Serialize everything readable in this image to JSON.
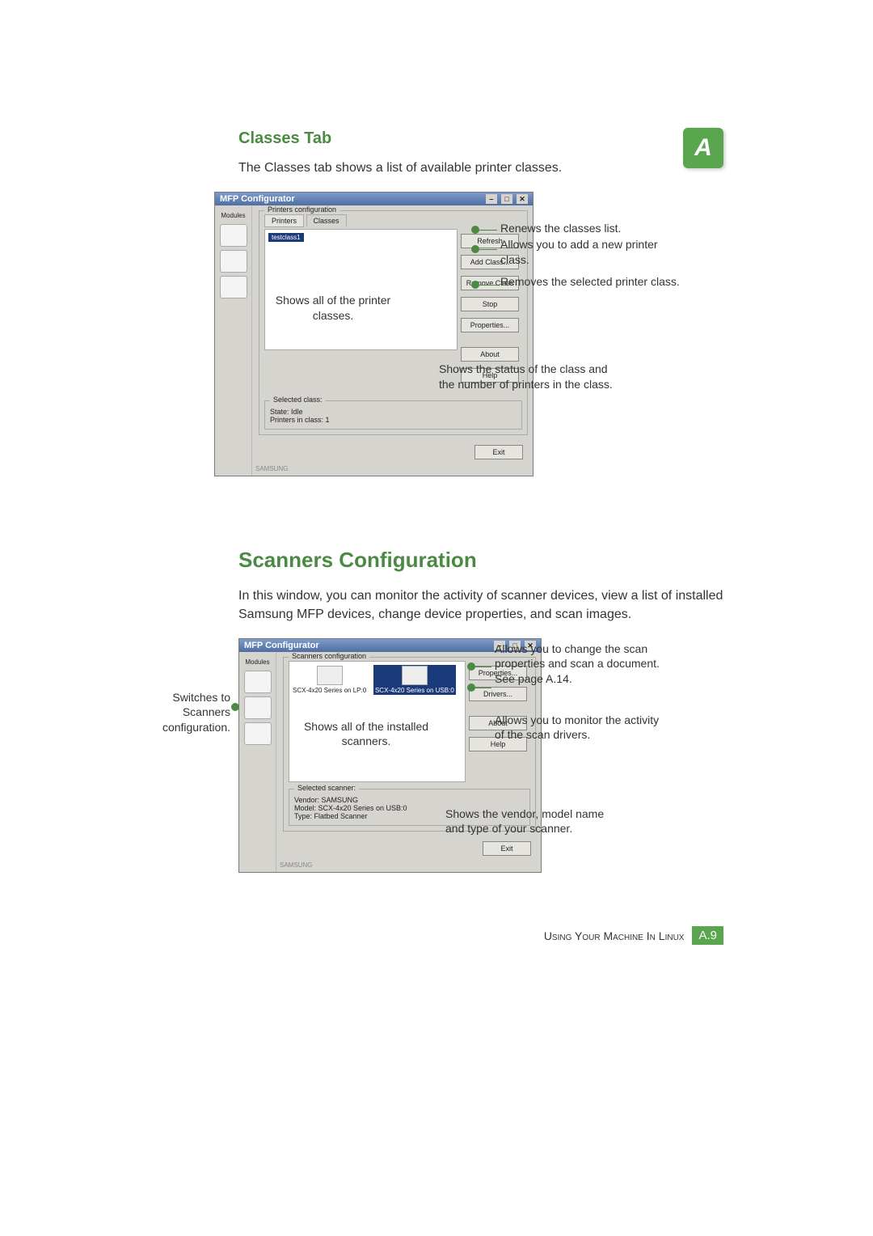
{
  "appendix_letter": "A",
  "classes": {
    "heading": "Classes Tab",
    "intro": "The Classes tab shows a list of available printer classes.",
    "win_title": "MFP Configurator",
    "modules_label": "Modules",
    "group_label": "Printers configuration",
    "tabs": {
      "printers": "Printers",
      "classes": "Classes"
    },
    "list_item": "testclass1",
    "buttons": {
      "refresh": "Refresh",
      "add": "Add Class...",
      "remove": "Remove Class",
      "stop": "Stop",
      "properties": "Properties...",
      "about": "About",
      "help": "Help"
    },
    "selected": {
      "title": "Selected class:",
      "state": "State: Idle",
      "count": "Printers in class: 1"
    },
    "exit": "Exit",
    "brand": "SAMSUNG",
    "callouts": {
      "all_classes": "Shows all of the printer classes.",
      "refresh": "Renews the classes list.",
      "add": "Allows you to add a new printer class.",
      "remove": "Removes the selected printer class.",
      "status": "Shows the status of the class and the number of printers in the class."
    }
  },
  "scanners": {
    "heading": "Scanners Configuration",
    "intro": "In this window, you can monitor the activity of scanner devices, view a list of installed Samsung MFP devices, change device properties, and scan images.",
    "win_title": "MFP Configurator",
    "modules_label": "Modules",
    "group_label": "Scanners configuration",
    "items": {
      "a": "SCX-4x20 Series on LP:0",
      "b": "SCX-4x20 Series on USB:0"
    },
    "buttons": {
      "properties": "Properties...",
      "drivers": "Drivers...",
      "about": "About",
      "help": "Help"
    },
    "selected": {
      "title": "Selected scanner:",
      "vendor": "Vendor: SAMSUNG",
      "model": "Model: SCX-4x20 Series on USB:0",
      "type": "Type: Flatbed Scanner"
    },
    "exit": "Exit",
    "brand": "SAMSUNG",
    "callouts": {
      "switch": "Switches to Scanners configuration.",
      "all_scanners": "Shows all of the installed scanners.",
      "properties": "Allows you to change the scan properties and scan a document. See page A.14.",
      "drivers": "Allows you to monitor the activity of the scan drivers.",
      "info": "Shows the vendor, model name and type of your scanner."
    }
  },
  "footer": {
    "chapter": "Using Your Machine In Linux",
    "page": "A.9"
  }
}
